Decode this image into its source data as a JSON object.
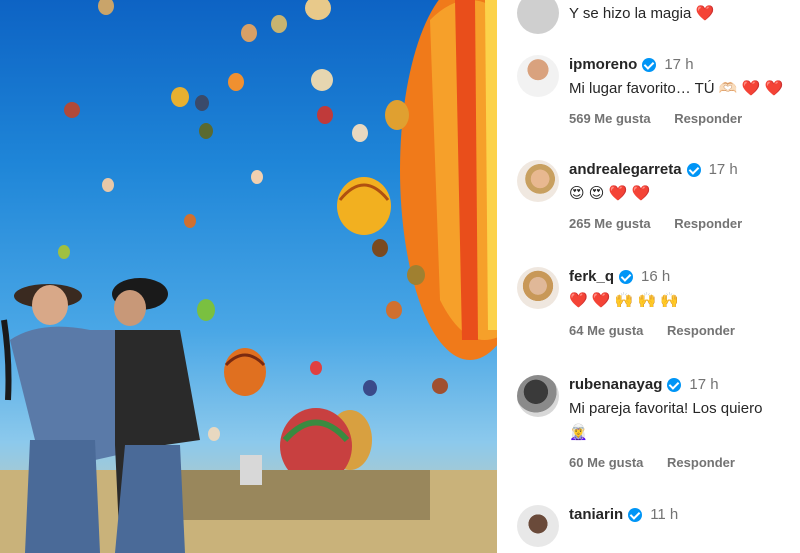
{
  "comments": [
    {
      "username": "",
      "time": "",
      "text": "Y se hizo la magia ❤️",
      "likes": "",
      "reply": ""
    },
    {
      "username": "ipmoreno",
      "time": "17 h",
      "text": "Mi lugar favorito… TÚ 🫶🏻 ❤️ ❤️",
      "likes": "569 Me gusta",
      "reply": "Responder"
    },
    {
      "username": "andrealegarreta",
      "time": "17 h",
      "text": "😍 😍 ❤️ ❤️",
      "likes": "265 Me gusta",
      "reply": "Responder"
    },
    {
      "username": "ferk_q",
      "time": "16 h",
      "text": "❤️ ❤️ 🙌 🙌 🙌",
      "likes": "64 Me gusta",
      "reply": "Responder"
    },
    {
      "username": "rubenanayag",
      "time": "17 h",
      "text": "Mi pareja favorita! Los quiero",
      "text2": "🧝‍♀️",
      "likes": "60 Me gusta",
      "reply": "Responder"
    },
    {
      "username": "taniarin",
      "time": "11 h",
      "text": "",
      "likes": "",
      "reply": ""
    }
  ],
  "colors": {
    "verified": "#0095f6",
    "heart": "#e0245e",
    "secondary_text": "#737373"
  }
}
